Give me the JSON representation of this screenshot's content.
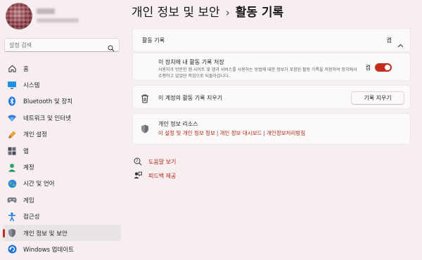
{
  "colors": {
    "accent": "#c42b1c",
    "link": "#b3261e",
    "background": "#f6eeef"
  },
  "search": {
    "placeholder": "설정 검색",
    "icon": "search-icon"
  },
  "sidebar": {
    "items": [
      {
        "label": "홈",
        "icon": "home-icon"
      },
      {
        "label": "시스템",
        "icon": "system-icon"
      },
      {
        "label": "Bluetooth 및 장치",
        "icon": "bluetooth-icon"
      },
      {
        "label": "네트워크 및 인터넷",
        "icon": "network-icon"
      },
      {
        "label": "개인 설정",
        "icon": "brush-icon"
      },
      {
        "label": "앱",
        "icon": "apps-icon"
      },
      {
        "label": "계정",
        "icon": "account-icon"
      },
      {
        "label": "시간 및 언어",
        "icon": "globe-icon"
      },
      {
        "label": "게임",
        "icon": "gaming-icon"
      },
      {
        "label": "접근성",
        "icon": "accessibility-icon"
      },
      {
        "label": "개인 정보 및 보안",
        "icon": "shield-icon",
        "active": true
      },
      {
        "label": "Windows 업데이트",
        "icon": "update-icon"
      }
    ]
  },
  "breadcrumb": {
    "parent": "개인 정보 및 보안",
    "separator": "›",
    "current": "활동 기록"
  },
  "activity_section": {
    "title": "활동 기록",
    "state": "켬"
  },
  "store_setting": {
    "title": "이 장치에 내 활동 기록 저장",
    "description": "사용자가 방문한 앱 사이트 및 앱과 서비스를 사용하는 방법에 대한 정보가 포함된 활동 기록을 저장하여 장치에서 수행하고 있었던 작업으로 되돌아갑니다.",
    "state": "켬",
    "toggle_on": true
  },
  "clear_history": {
    "title": "이 계정의 활동 기록 지우기",
    "button": "기록 지우기"
  },
  "resources": {
    "title": "개인 정보 리소스",
    "links": [
      "이 설정 및 개인 정보 정보",
      "개인 정보 대시보드",
      "개인정보처리방침"
    ],
    "divider": "|"
  },
  "help": {
    "get_help": "도움말 보기",
    "feedback": "피드백 제공"
  }
}
